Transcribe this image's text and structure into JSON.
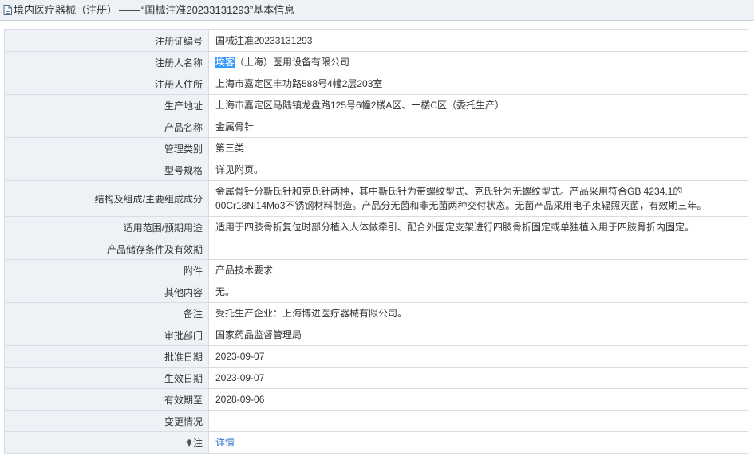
{
  "header": {
    "icon": "document-icon",
    "category": "境内医疗器械（注册）",
    "separator": "——",
    "record_title": "“国械注准20233131293”基本信息"
  },
  "rows": [
    {
      "label": "注册证编号",
      "value": "国械注准20233131293"
    },
    {
      "label": "注册人名称",
      "value_selected": "埃客",
      "value_rest": "（上海）医用设备有限公司"
    },
    {
      "label": "注册人住所",
      "value": "上海市嘉定区丰功路588号4幢2层203室"
    },
    {
      "label": "生产地址",
      "value": "上海市嘉定区马陆镇龙盘路125号6幢2楼A区、一楼C区（委托生产）"
    },
    {
      "label": "产品名称",
      "value": "金属骨针"
    },
    {
      "label": "管理类别",
      "value": "第三类"
    },
    {
      "label": "型号规格",
      "value": "详见附页。"
    },
    {
      "label": "结构及组成/主要组成成分",
      "value": "金属骨针分斯氏针和克氏针两种，其中斯氏针为带螺纹型式、克氏针为无螺纹型式。产品采用符合GB 4234.1的00Cr18Ni14Mo3不锈钢材料制造。产品分无菌和非无菌两种交付状态。无菌产品采用电子束辐照灭菌，有效期三年。"
    },
    {
      "label": "适用范围/预期用途",
      "value": "适用于四肢骨折复位时部分植入人体做牵引、配合外固定支架进行四肢骨折固定或单独植入用于四肢骨折内固定。"
    },
    {
      "label": "产品储存条件及有效期",
      "value": ""
    },
    {
      "label": "附件",
      "value": "产品技术要求"
    },
    {
      "label": "其他内容",
      "value": "无。"
    },
    {
      "label": "备注",
      "value": "受托生产企业：上海博进医疗器械有限公司。"
    },
    {
      "label": "审批部门",
      "value": "国家药品监督管理局"
    },
    {
      "label": "批准日期",
      "value": "2023-09-07"
    },
    {
      "label": "生效日期",
      "value": "2023-09-07"
    },
    {
      "label": "有效期至",
      "value": "2028-09-06"
    },
    {
      "label": "变更情况",
      "value": ""
    },
    {
      "label": "注",
      "label_icon": "pin-icon",
      "link": "详情"
    }
  ],
  "colors": {
    "header_bg": "#eef2f6",
    "label_bg": "#eef1f5",
    "border": "#d6dde5",
    "link": "#2d73c9",
    "selection": "#3399ff"
  }
}
